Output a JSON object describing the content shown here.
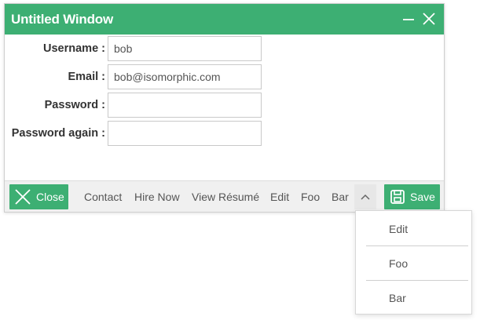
{
  "window": {
    "title": "Untitled Window"
  },
  "form": {
    "username_label": "Username :",
    "username_value": "bob",
    "email_label": "Email :",
    "email_value": "bob@isomorphic.com",
    "password_label": "Password :",
    "password_value": "",
    "password_again_label": "Password again :",
    "password_again_value": ""
  },
  "toolbar": {
    "close_label": "Close",
    "links": [
      "Contact",
      "Hire Now",
      "View Résumé",
      "Edit",
      "Foo",
      "Bar"
    ],
    "save_label": "Save"
  },
  "overflow_menu": {
    "items": [
      "Edit",
      "Foo",
      "Bar"
    ]
  },
  "colors": {
    "accent": "#3daf73",
    "toolbar_bg": "#f0f0f0",
    "text": "#555555"
  }
}
